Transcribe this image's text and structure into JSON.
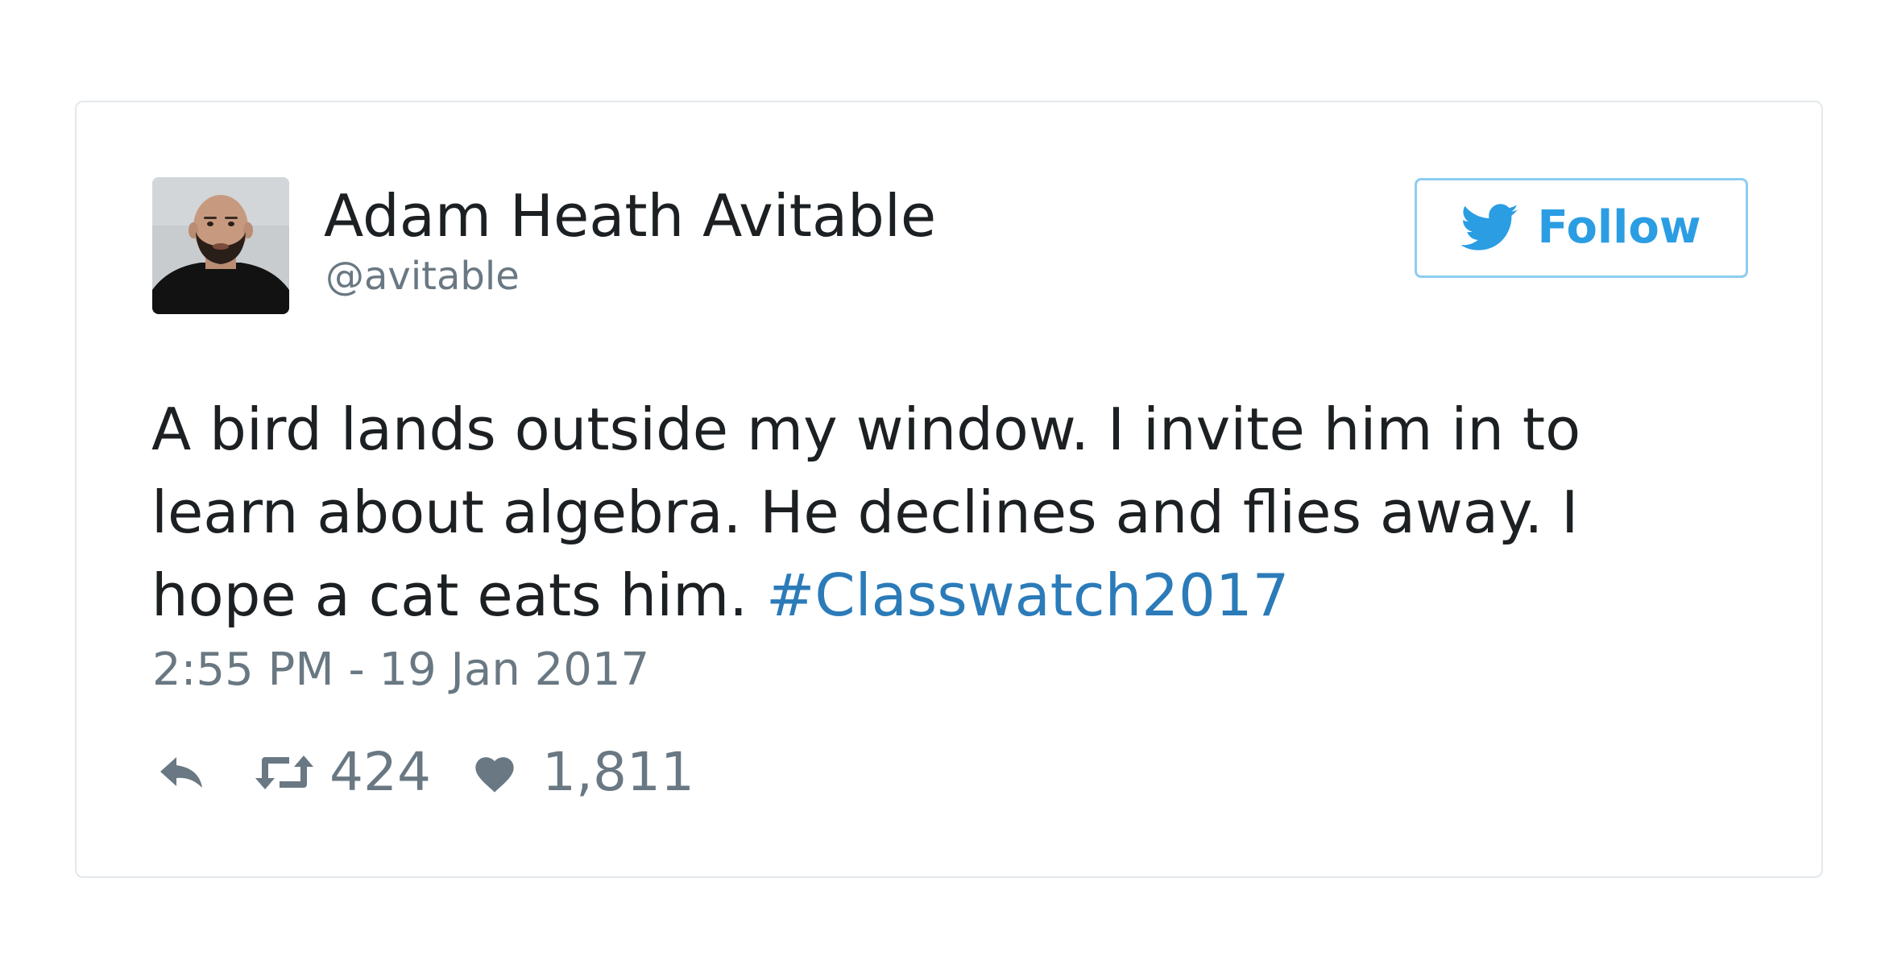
{
  "tweet": {
    "author": {
      "name": "Adam Heath Avitable",
      "handle": "@avitable"
    },
    "follow_label": "Follow",
    "text": "A bird lands outside my window. I invite him in to learn about algebra. He declines and flies away. I hope a cat eats him. ",
    "hashtag": "#Classwatch2017",
    "timestamp": "2:55 PM - 19 Jan 2017",
    "retweet_count": "424",
    "like_count": "1,811"
  },
  "colors": {
    "text": "#1c2022",
    "muted": "#697882",
    "link": "#2b7bb9",
    "follow_blue": "#2b9de3",
    "follow_border": "#8dcdf0",
    "card_border": "#e3e8ec"
  },
  "icons": {
    "follow": "twitter-bird-icon",
    "reply": "reply-arrow-icon",
    "retweet": "retweet-icon",
    "like": "heart-icon"
  }
}
